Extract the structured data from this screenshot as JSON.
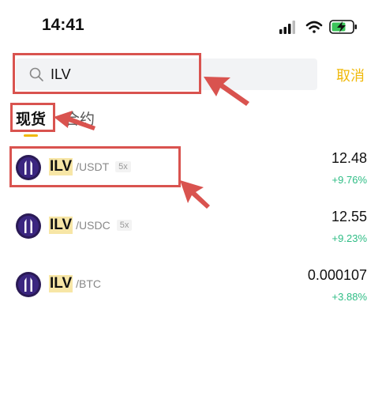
{
  "status": {
    "time": "14:41"
  },
  "search": {
    "value": "ILV",
    "placeholder": ""
  },
  "cancel_label": "取消",
  "tabs": [
    {
      "label": "现货",
      "active": true
    },
    {
      "label": "合约",
      "active": false
    }
  ],
  "results": [
    {
      "base": "ILV",
      "quote": "/USDT",
      "leverage": "5x",
      "price": "12.48",
      "change": "+9.76%"
    },
    {
      "base": "ILV",
      "quote": "/USDC",
      "leverage": "5x",
      "price": "12.55",
      "change": "+9.23%"
    },
    {
      "base": "ILV",
      "quote": "/BTC",
      "price": "0.000107",
      "change": "+3.88%"
    }
  ],
  "colors": {
    "accent": "#f0b90b",
    "positive": "#2ebd85",
    "annotation": "#d9534f",
    "highlight": "#f7e6a6"
  }
}
